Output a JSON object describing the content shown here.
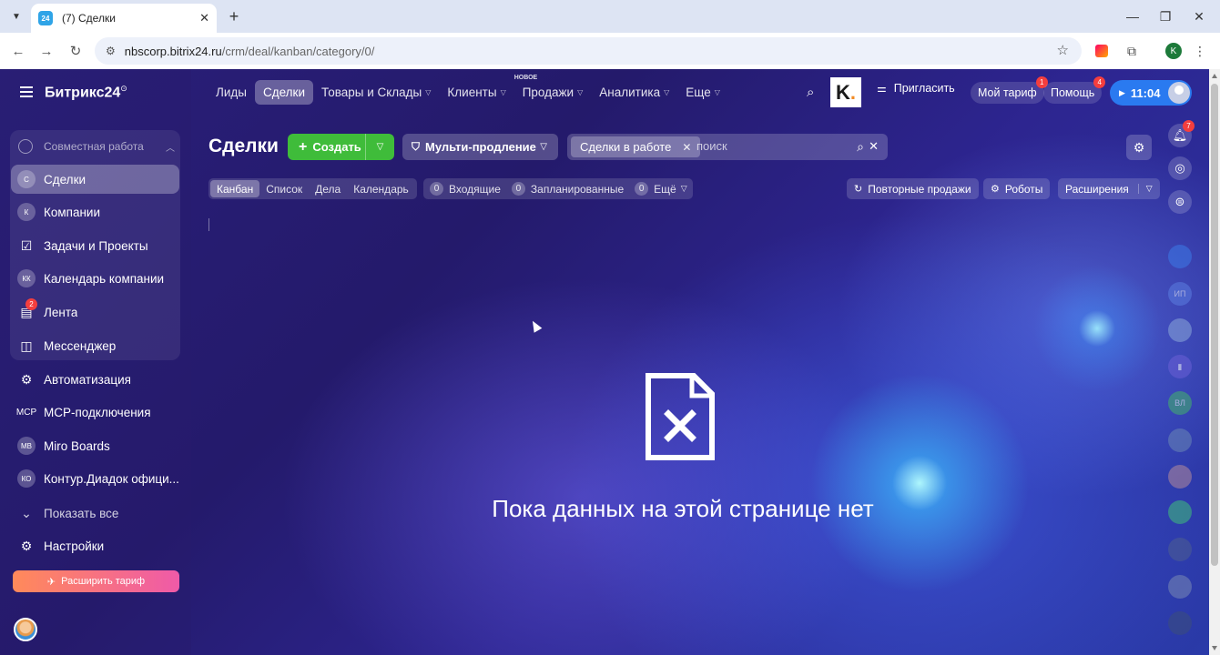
{
  "browser": {
    "tab_title": "(7) Сделки",
    "tab_favicon": "24",
    "url_host": "nbscorp.bitrix24.ru",
    "url_path": "/crm/deal/kanban/category/0/",
    "profile_initial": "K"
  },
  "sidebar": {
    "brand": "Битрикс24",
    "group_label": "Совместная работа",
    "items": [
      {
        "label": "Сделки",
        "avatar": "С"
      },
      {
        "label": "Компании",
        "avatar": "К"
      },
      {
        "label": "Задачи и Проекты",
        "icon": "☑"
      },
      {
        "label": "Календарь компании",
        "avatar": "КК"
      },
      {
        "label": "Лента",
        "icon": "▤",
        "badge": "2"
      },
      {
        "label": "Мессенджер",
        "icon": "◫"
      },
      {
        "label": "Автоматизация",
        "icon": "⚙"
      },
      {
        "label": "MCP-подключения",
        "icon": "MCP"
      },
      {
        "label": "Miro Boards",
        "avatar": "MB"
      },
      {
        "label": "Контур.Диадок офици...",
        "avatar": "КО"
      },
      {
        "label": "Показать все",
        "icon": "⌄"
      },
      {
        "label": "Настройки",
        "icon": "⚙"
      }
    ],
    "upgrade_label": "Расширить тариф"
  },
  "topnav": {
    "items": [
      {
        "label": "Лиды",
        "dropdown": false
      },
      {
        "label": "Сделки",
        "dropdown": false
      },
      {
        "label": "Товары и Склады",
        "dropdown": true
      },
      {
        "label": "Клиенты",
        "dropdown": true
      },
      {
        "label": "Продажи",
        "dropdown": true,
        "tag": "НОВОЕ"
      },
      {
        "label": "Аналитика",
        "dropdown": true
      },
      {
        "label": "Еще",
        "dropdown": true
      }
    ],
    "invite_label": "Пригласить",
    "tariff_label": "Мой тариф",
    "tariff_badge": "1",
    "help_label": "Помощь",
    "help_badge": "4",
    "time": "11:04"
  },
  "toolbar": {
    "title": "Сделки",
    "create_label": "Создать",
    "multi_label": "Мульти-продление",
    "filter_chip": "Сделки в работе",
    "search_placeholder": "поиск"
  },
  "views": {
    "tabs": [
      "Канбан",
      "Список",
      "Дела",
      "Календарь"
    ],
    "counters": [
      {
        "num": "0",
        "label": "Входящие"
      },
      {
        "num": "0",
        "label": "Запланированные"
      },
      {
        "num": "0",
        "label": "Ещё"
      }
    ],
    "repeat_sales_label": "Повторные продажи",
    "robots_label": "Роботы",
    "extensions_label": "Расширения"
  },
  "empty_state": {
    "message": "Пока данных на этой странице нет"
  },
  "right_rail": {
    "notifications_badge": "7",
    "avatars": [
      "ИП",
      "ВЛ"
    ]
  },
  "colors": {
    "accent_green": "#3fbc3a",
    "accent_blue": "#2a7af0",
    "badge_red": "#f43e3e",
    "upgrade_gradient_start": "#ff8a5a",
    "upgrade_gradient_end": "#ef5aa8"
  }
}
